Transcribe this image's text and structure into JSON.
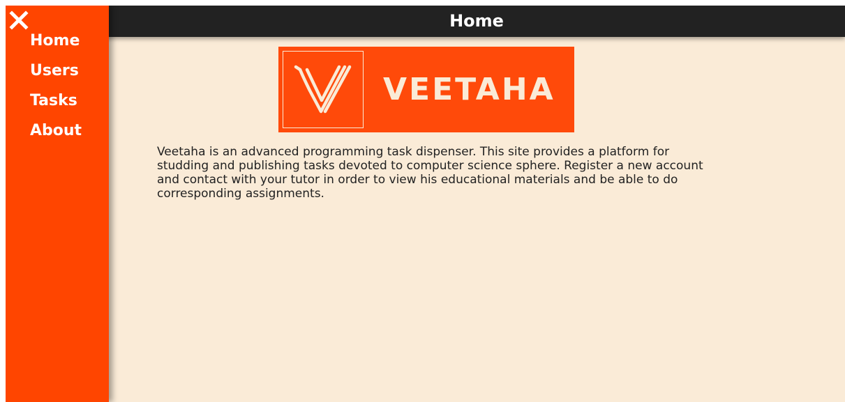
{
  "header": {
    "title": "Home"
  },
  "sidebar": {
    "close_icon": "close-icon",
    "items": [
      {
        "label": "Home"
      },
      {
        "label": "Users"
      },
      {
        "label": "Tasks"
      },
      {
        "label": "About"
      }
    ]
  },
  "logo": {
    "text": "VEETAHA",
    "icon": "veetaha-v-logo-icon"
  },
  "main": {
    "description": "Veetaha is an advanced programming task dispenser. This site provides a platform for studding and publishing tasks devoted to computer science sphere. Register a new account and contact with your tutor in order to view his educational materials and be able to do corresponding assignments."
  },
  "colors": {
    "accent": "#ff4500",
    "background": "#faebd7",
    "topbar": "#222222",
    "text": "#222222"
  }
}
